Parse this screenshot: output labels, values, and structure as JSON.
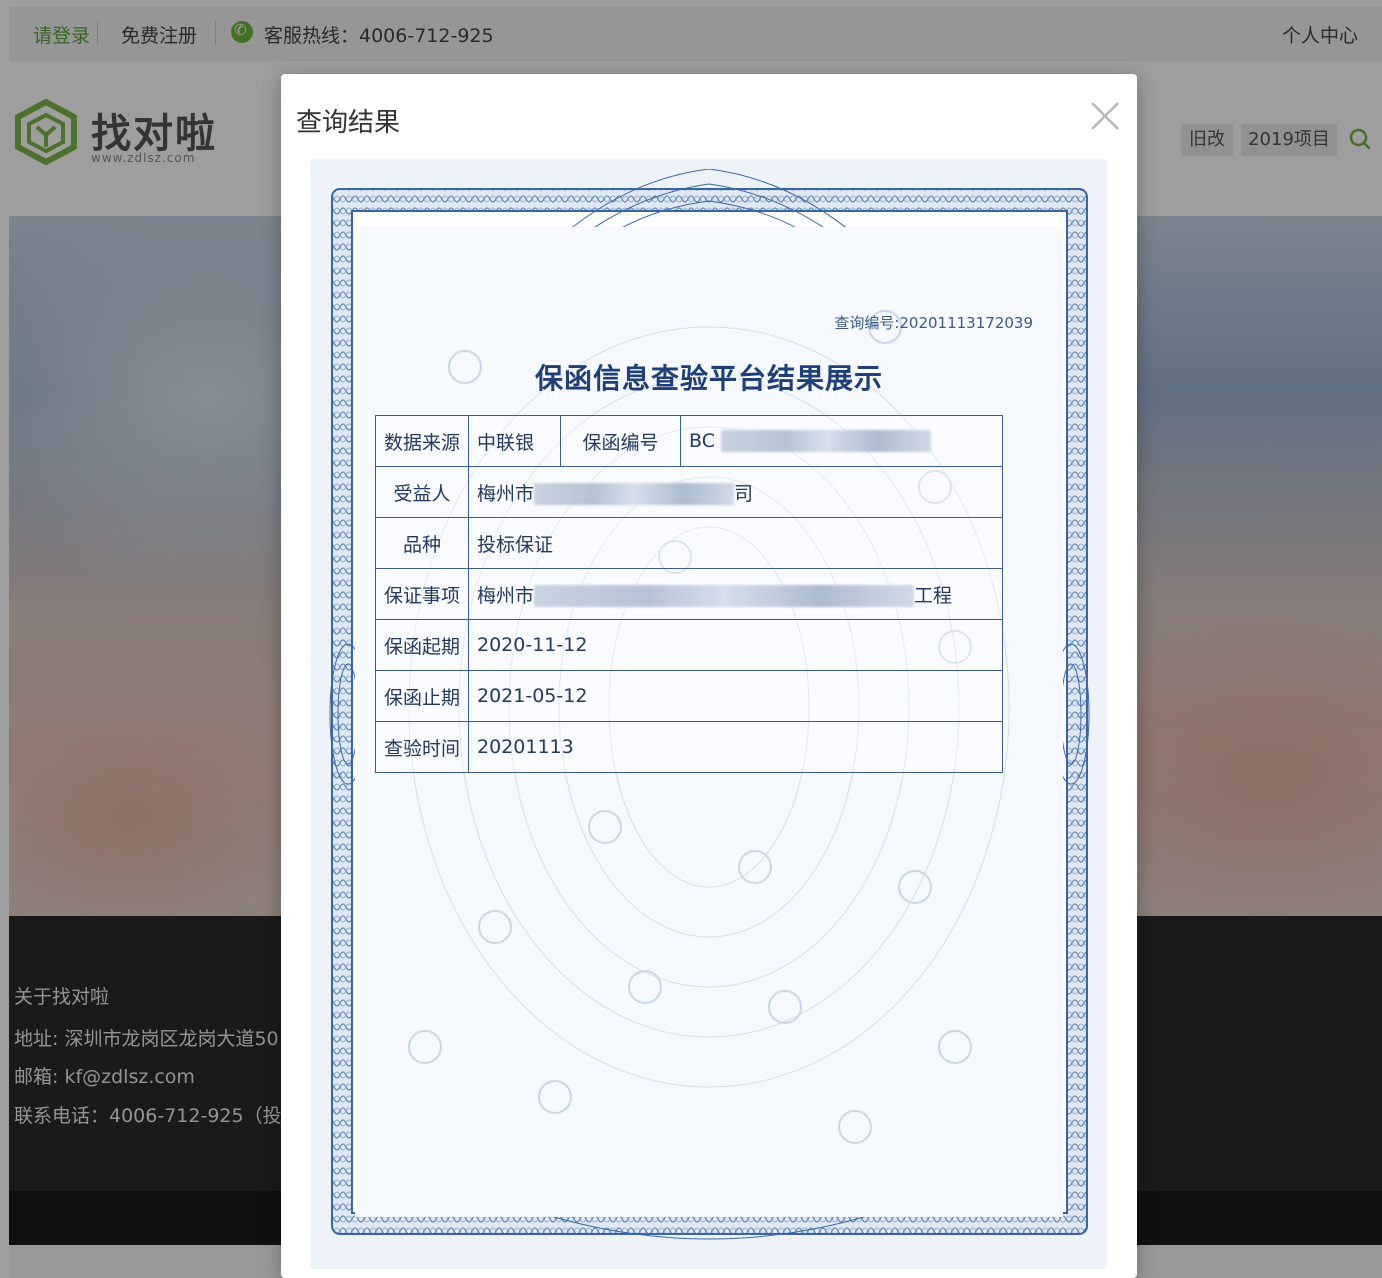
{
  "topbar": {
    "login": "请登录",
    "register": "免费注册",
    "hotline": "客服热线：4006-712-925",
    "user_center": "个人中心"
  },
  "header": {
    "logo_text": "找对啦",
    "logo_url": "www.zdlsz.com",
    "old_label": "旧改",
    "year_label": "2019项目"
  },
  "footer": {
    "title": "关于找对啦",
    "address": "地址: 深圳市龙岗区龙岗大道50",
    "email": "邮箱:  kf@zdlsz.com",
    "phone": "联系电话：4006-712-925（投"
  },
  "modal": {
    "title": "查询结果"
  },
  "certificate": {
    "query_no": "查询编号:20201113172039",
    "title": "保函信息查验平台结果展示",
    "rows": {
      "source_label": "数据来源",
      "source_value": "中联银",
      "guarantee_no_label": "保函编号",
      "guarantee_no_value": "BC",
      "beneficiary_label": "受益人",
      "beneficiary_value_prefix": "梅州市",
      "beneficiary_value_suffix": "司",
      "variety_label": "品种",
      "variety_value": "投标保证",
      "matter_label": "保证事项",
      "matter_value_prefix": "梅州市",
      "matter_value_suffix": "工程",
      "start_label": "保函起期",
      "start_value": "2020-11-12",
      "end_label": "保函止期",
      "end_value": "2021-05-12",
      "check_label": "查验时间",
      "check_value": "20201113"
    }
  },
  "colors": {
    "accent_green": "#6fb43f",
    "cert_blue": "#2f5b9e",
    "title_blue": "#1e3f78"
  }
}
